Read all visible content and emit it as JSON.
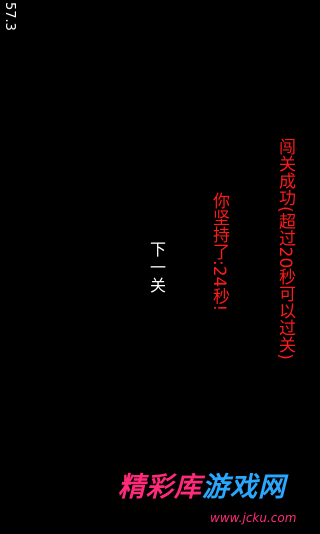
{
  "status": {
    "fps_value": "57.3"
  },
  "result": {
    "success_message": "闯关成功(超过20秒可以过关)",
    "survived_message": "你坚持了:24秒!",
    "next_button_label": "下一关"
  },
  "watermark": {
    "part1": "精彩库",
    "part2": "游戏网",
    "url": "www.jcku.com"
  },
  "colors": {
    "background": "#000000",
    "message": "#ff1a1a",
    "button_text": "#ffffff",
    "watermark_pink": "#ff2a7a",
    "watermark_blue": "#2aa7ff"
  }
}
